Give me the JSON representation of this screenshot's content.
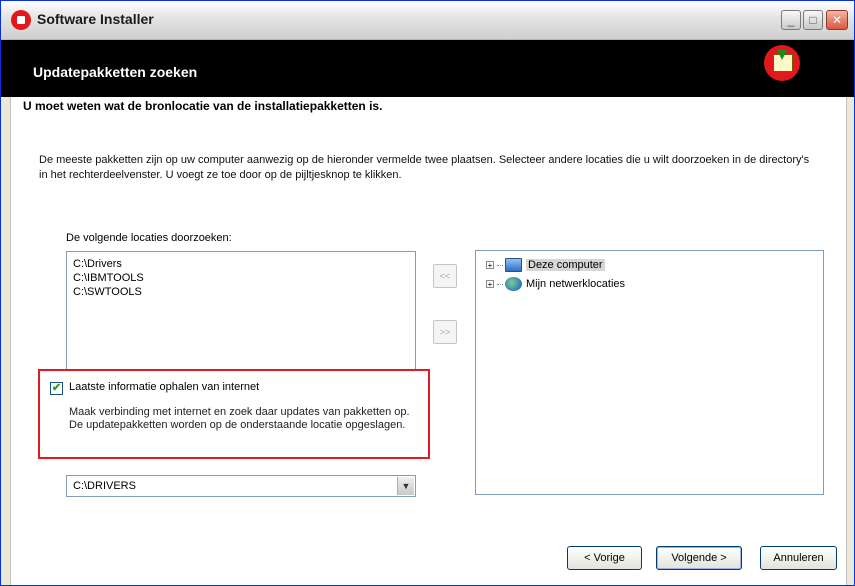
{
  "window": {
    "title": "Software Installer"
  },
  "header": {
    "title": "Updatepakketten zoeken"
  },
  "subtitle": "U moet weten wat de bronlocatie van de installatiepakketten is.",
  "description": "De meeste pakketten zijn op uw computer aanwezig op de hieronder vermelde twee plaatsen. Selecteer andere locaties die u wilt doorzoeken in de directory's in het rechterdeelvenster. U voegt ze toe door op de pijltjesknop te klikken.",
  "search_locations": {
    "label": "De volgende locaties doorzoeken:",
    "items": [
      "C:\\Drivers",
      "C:\\IBMTOOLS",
      "C:\\SWTOOLS"
    ]
  },
  "arrows": {
    "add": "<<",
    "remove": ">>"
  },
  "tree": {
    "items": [
      {
        "label": "Deze computer",
        "expander": "+",
        "selected": true,
        "icon": "computer-icon"
      },
      {
        "label": "Mijn netwerklocaties",
        "expander": "+",
        "selected": false,
        "icon": "network-places-icon"
      }
    ]
  },
  "internet": {
    "checked": true,
    "check_glyph": "✔",
    "label": "Laatste informatie ophalen van internet",
    "description": "Maak verbinding met internet en zoek daar updates van pakketten op. De updatepakketten worden op de onderstaande locatie opgeslagen."
  },
  "download_location": {
    "value": "C:\\DRIVERS",
    "dropdown_glyph": "▼"
  },
  "buttons": {
    "back": "< Vorige",
    "next": "Volgende >",
    "cancel": "Annuleren"
  },
  "colors": {
    "highlight_border": "#e31b23",
    "header_bg": "#000000",
    "brand_red": "#e4181c"
  }
}
